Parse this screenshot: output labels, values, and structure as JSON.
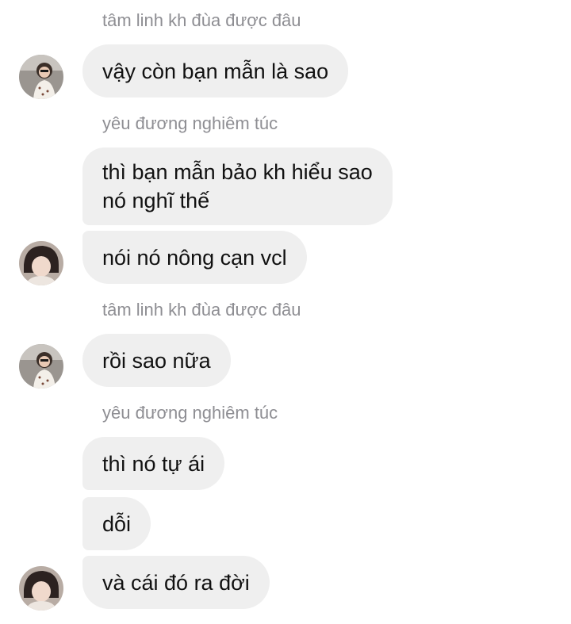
{
  "conversation": {
    "messages": [
      {
        "sender": "tâm linh kh đùa được đâu"
      },
      {
        "text": "vậy còn bạn mẫn là sao"
      },
      {
        "sender": "yêu đương nghiêm túc"
      },
      {
        "text_line1": "thì bạn mẫn bảo kh hiểu sao",
        "text_line2": "nó nghĩ thế"
      },
      {
        "text": "nói nó nông cạn vcl"
      },
      {
        "sender": "tâm linh kh đùa được đâu"
      },
      {
        "text": "rồi sao nữa"
      },
      {
        "sender": "yêu đương nghiêm túc"
      },
      {
        "text": "thì nó tự ái"
      },
      {
        "text": "dỗi"
      },
      {
        "text": "và cái đó ra đời"
      }
    ]
  },
  "colors": {
    "bubble_background": "#efefef",
    "sender_name": "#8e8e93",
    "message_text": "#111111"
  }
}
